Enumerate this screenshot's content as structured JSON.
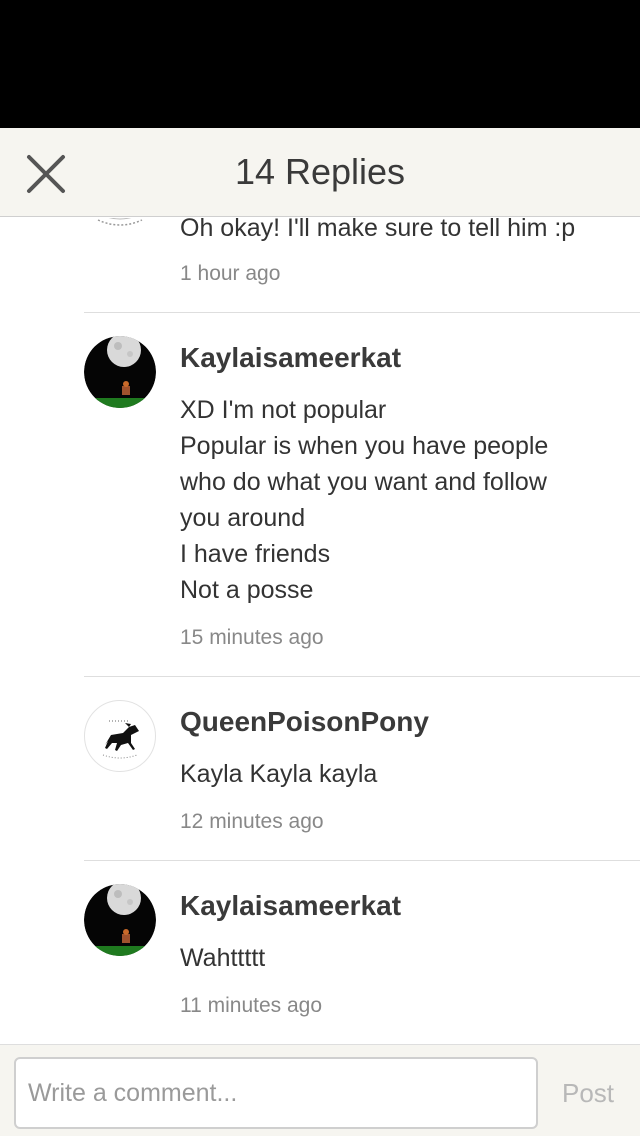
{
  "header": {
    "title": "14 Replies"
  },
  "replies": [
    {
      "comment": "Oh okay! I'll make sure to tell him :p",
      "time": "1 hour ago"
    },
    {
      "username": "Kaylaisameerkat",
      "avatar_icon": "moon-night-avatar-icon",
      "comment_lines": [
        "XD I'm not popular",
        "Popular is when you have people",
        "who do what you want and follow",
        "you around",
        "I have friends",
        "Not a posse"
      ],
      "time": "15 minutes ago"
    },
    {
      "username": "QueenPoisonPony",
      "avatar_icon": "horse-avatar-icon",
      "comment": "Kayla Kayla kayla",
      "time": "12 minutes ago"
    },
    {
      "username": "Kaylaisameerkat",
      "avatar_icon": "moon-night-avatar-icon",
      "comment": "Wahttttt",
      "time": "11 minutes ago"
    }
  ],
  "composer": {
    "placeholder": "Write a comment...",
    "post_label": "Post"
  },
  "colors": {
    "header_bg": "#f6f5f0",
    "status_bar": "#000000",
    "muted_text": "#888888",
    "post_disabled": "#b8b8b8"
  }
}
